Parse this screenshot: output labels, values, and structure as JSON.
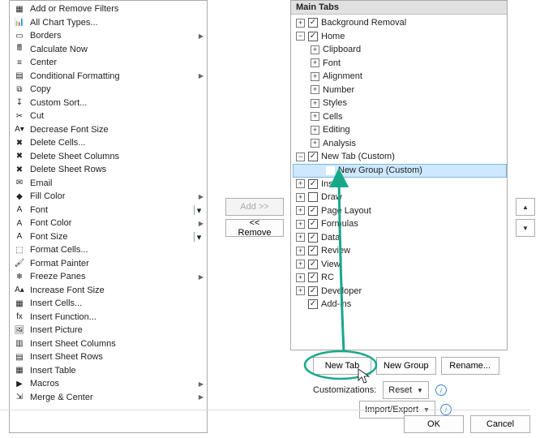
{
  "left_commands": [
    {
      "icon": "▦",
      "label": "Add or Remove Filters"
    },
    {
      "icon": "📊",
      "label": "All Chart Types..."
    },
    {
      "icon": "▭",
      "label": "Borders",
      "submenu": true
    },
    {
      "icon": "🖩",
      "label": "Calculate Now"
    },
    {
      "icon": "≡",
      "label": "Center"
    },
    {
      "icon": "▤",
      "label": "Conditional Formatting",
      "submenu": true
    },
    {
      "icon": "⧉",
      "label": "Copy"
    },
    {
      "icon": "↧",
      "label": "Custom Sort..."
    },
    {
      "icon": "✂",
      "label": "Cut"
    },
    {
      "icon": "A▾",
      "label": "Decrease Font Size"
    },
    {
      "icon": "✖",
      "label": "Delete Cells..."
    },
    {
      "icon": "✖",
      "label": "Delete Sheet Columns"
    },
    {
      "icon": "✖",
      "label": "Delete Sheet Rows"
    },
    {
      "icon": "✉",
      "label": "Email"
    },
    {
      "icon": "◆",
      "label": "Fill Color",
      "submenu": true
    },
    {
      "icon": "A",
      "label": "Font",
      "dropdown": true
    },
    {
      "icon": "A",
      "label": "Font Color",
      "submenu": true
    },
    {
      "icon": "A",
      "label": "Font Size",
      "dropdown": true
    },
    {
      "icon": "⬚",
      "label": "Format Cells..."
    },
    {
      "icon": "🖌",
      "label": "Format Painter"
    },
    {
      "icon": "❄",
      "label": "Freeze Panes",
      "submenu": true
    },
    {
      "icon": "A▴",
      "label": "Increase Font Size"
    },
    {
      "icon": "▦",
      "label": "Insert Cells..."
    },
    {
      "icon": "fx",
      "label": "Insert Function..."
    },
    {
      "icon": "🖼",
      "label": "Insert Picture"
    },
    {
      "icon": "▥",
      "label": "Insert Sheet Columns"
    },
    {
      "icon": "▤",
      "label": "Insert Sheet Rows"
    },
    {
      "icon": "▦",
      "label": "Insert Table"
    },
    {
      "icon": "▶",
      "label": "Macros",
      "submenu": true
    },
    {
      "icon": "⇲",
      "label": "Merge & Center",
      "submenu": true
    }
  ],
  "right_header": "Main Tabs",
  "right_tree": [
    {
      "depth": 1,
      "exp": "+",
      "chk": true,
      "label": "Background Removal"
    },
    {
      "depth": 1,
      "exp": "-",
      "chk": true,
      "label": "Home"
    },
    {
      "depth": 2,
      "exp": "+",
      "label": "Clipboard"
    },
    {
      "depth": 2,
      "exp": "+",
      "label": "Font"
    },
    {
      "depth": 2,
      "exp": "+",
      "label": "Alignment"
    },
    {
      "depth": 2,
      "exp": "+",
      "label": "Number"
    },
    {
      "depth": 2,
      "exp": "+",
      "label": "Styles"
    },
    {
      "depth": 2,
      "exp": "+",
      "label": "Cells"
    },
    {
      "depth": 2,
      "exp": "+",
      "label": "Editing"
    },
    {
      "depth": 2,
      "exp": "+",
      "label": "Analysis"
    },
    {
      "depth": 1,
      "exp": "-",
      "chk": true,
      "label": "New Tab (Custom)"
    },
    {
      "depth": 3,
      "label": "New Group (Custom)",
      "selected": true
    },
    {
      "depth": 1,
      "exp": "+",
      "chk": true,
      "label": "Insert"
    },
    {
      "depth": 1,
      "exp": "+",
      "chk": false,
      "label": "Draw"
    },
    {
      "depth": 1,
      "exp": "+",
      "chk": true,
      "label": "Page Layout"
    },
    {
      "depth": 1,
      "exp": "+",
      "chk": true,
      "label": "Formulas"
    },
    {
      "depth": 1,
      "exp": "+",
      "chk": true,
      "label": "Data"
    },
    {
      "depth": 1,
      "exp": "+",
      "chk": true,
      "label": "Review"
    },
    {
      "depth": 1,
      "exp": "+",
      "chk": true,
      "label": "View"
    },
    {
      "depth": 1,
      "exp": "+",
      "chk": true,
      "label": "RC"
    },
    {
      "depth": 1,
      "exp": "+",
      "chk": true,
      "label": "Developer"
    },
    {
      "depth": 1,
      "chk": true,
      "label": "Add-ins"
    }
  ],
  "buttons": {
    "add": "Add >>",
    "remove": "<< Remove",
    "new_tab": "New Tab",
    "new_group": "New Group",
    "rename": "Rename...",
    "customizations_label": "Customizations:",
    "reset": "Reset",
    "import_export": "Import/Export",
    "ok": "OK",
    "cancel": "Cancel"
  },
  "annotation": {
    "color": "#17a88a"
  }
}
